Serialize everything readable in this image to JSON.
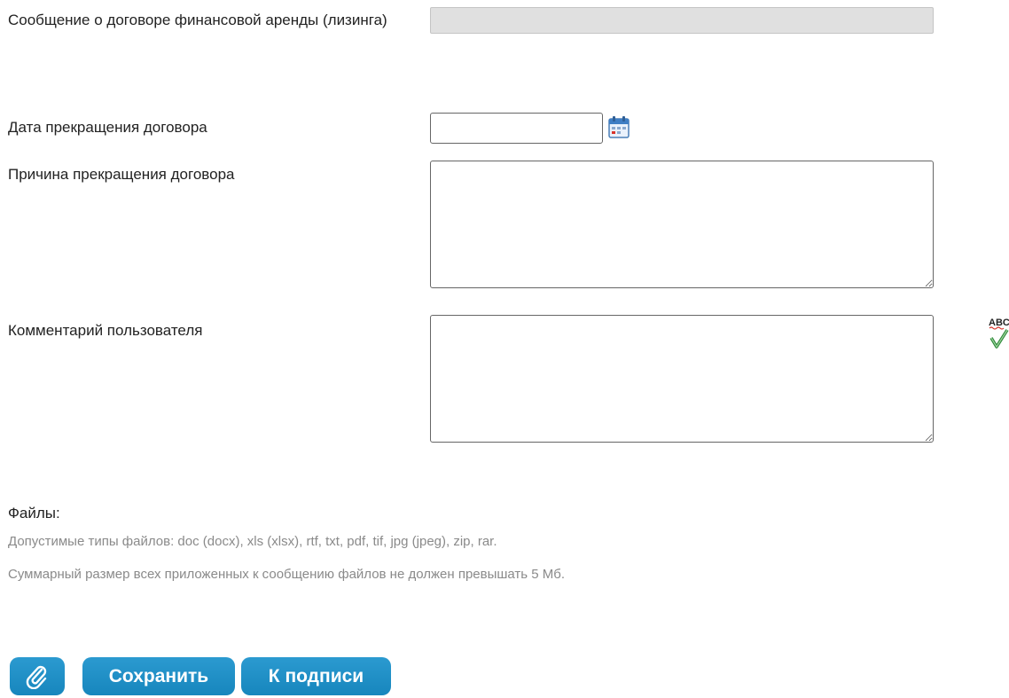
{
  "form": {
    "lease_message_label": "Сообщение о договоре финансовой аренды (лизинга)",
    "termination_date_label": "Дата прекращения договора",
    "termination_date_value": "",
    "termination_reason_label": "Причина прекращения договора",
    "termination_reason_value": "",
    "user_comment_label": "Комментарий пользователя",
    "user_comment_value": ""
  },
  "files": {
    "label": "Файлы:",
    "allowed_types_hint": "Допустимые типы файлов: doc (docx), xls (xlsx), rtf, txt, pdf, tif, jpg (jpeg), zip, rar.",
    "size_limit_hint": "Суммарный размер всех приложенных к сообщению файлов не должен превышать 5 Мб."
  },
  "icons": {
    "calendar": "calendar-icon",
    "spellcheck": "spellcheck-icon",
    "attach": "paperclip-icon",
    "spellcheck_text": "ABC"
  },
  "buttons": {
    "save_label": "Сохранить",
    "sign_label": "К подписи"
  },
  "colors": {
    "button_blue": "#1f8fc7",
    "hint_gray": "#8a8a8a",
    "readonly_gray": "#e0e0e0"
  }
}
